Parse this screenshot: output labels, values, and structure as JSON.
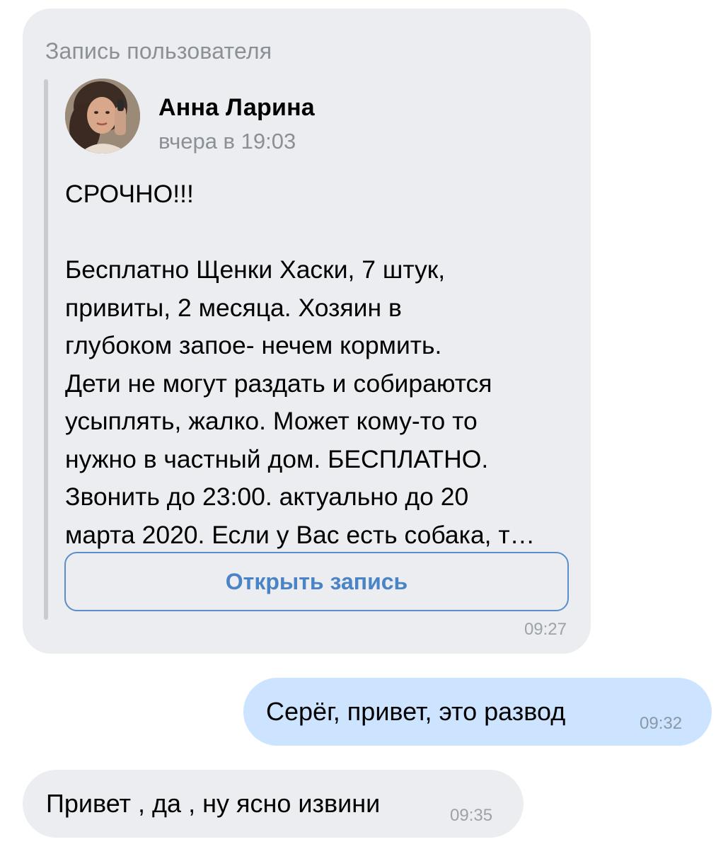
{
  "repost_message": {
    "label": "Запись пользователя",
    "author": {
      "name": "Анна Ларина",
      "time": "вчера в 19:03"
    },
    "text": "СРОЧНО!!!\n\nБесплатно Щенки Хаски, 7 штук,\nпривиты, 2 месяца. Хозяин в\nглубоком запое- нечем кормить.\nДети не могут раздать и собираются\nусыплять, жалко. Может кому-то то\nнужно в частный дом. БЕСПЛАТНО.\nЗвонить до 23:00. актуально до 20\nмарта 2020. Если у Вас есть собака, т…",
    "open_button_label": "Открыть запись",
    "timestamp": "09:27"
  },
  "outgoing_message": {
    "text": "Серёг, привет, это развод",
    "timestamp": "09:32"
  },
  "incoming_message": {
    "text": "Привет , да , ну ясно извини",
    "timestamp": "09:35"
  },
  "colors": {
    "incoming_bubble": "#ebedf0",
    "outgoing_bubble": "#cce4ff",
    "accent": "#4a84c6",
    "secondary_text": "#8b8f96"
  }
}
